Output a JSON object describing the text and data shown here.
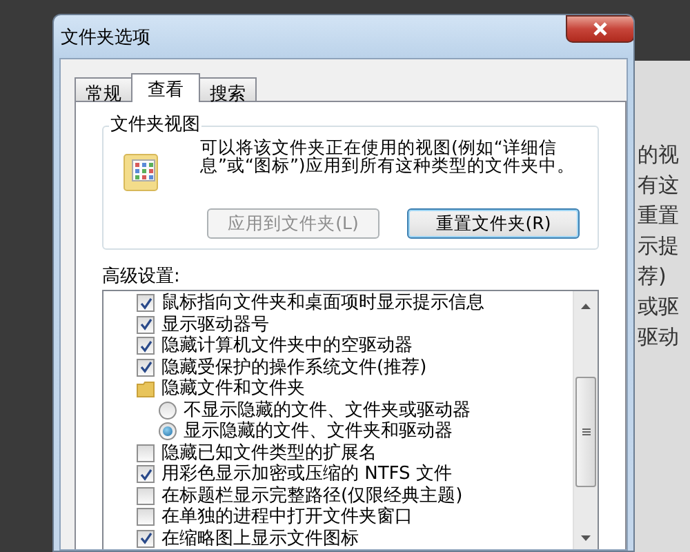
{
  "window": {
    "title": "文件夹选项"
  },
  "tabs": [
    {
      "label": "常规",
      "selected": false
    },
    {
      "label": "查看",
      "selected": true
    },
    {
      "label": "搜索",
      "selected": false
    }
  ],
  "folder_views": {
    "title": "文件夹视图",
    "description": "可以将该文件夹正在使用的视图(例如“详细信息”或“图标”)应用到所有这种类型的文件夹中。",
    "buttons": [
      {
        "label": "应用到文件夹(L)",
        "disabled": true
      },
      {
        "label": "重置文件夹(R)",
        "disabled": false
      }
    ]
  },
  "advanced": {
    "label": "高级设置:",
    "items": [
      {
        "kind": "checkbox",
        "label": "鼠标指向文件夹和桌面项时显示提示信息",
        "checked": true
      },
      {
        "kind": "checkbox",
        "label": "显示驱动器号",
        "checked": true
      },
      {
        "kind": "checkbox",
        "label": "隐藏计算机文件夹中的空驱动器",
        "checked": true
      },
      {
        "kind": "checkbox",
        "label": "隐藏受保护的操作系统文件(推荐)",
        "checked": true
      },
      {
        "kind": "folder",
        "label": "隐藏文件和文件夹",
        "children": [
          {
            "kind": "radio",
            "label": "不显示隐藏的文件、文件夹或驱动器",
            "selected": false
          },
          {
            "kind": "radio",
            "label": "显示隐藏的文件、文件夹和驱动器",
            "selected": true
          }
        ]
      },
      {
        "kind": "checkbox",
        "label": "隐藏已知文件类型的扩展名",
        "checked": false
      },
      {
        "kind": "checkbox",
        "label": "用彩色显示加密或压缩的 NTFS 文件",
        "checked": true
      },
      {
        "kind": "checkbox",
        "label": "在标题栏显示完整路径(仅限经典主题)",
        "checked": false
      },
      {
        "kind": "checkbox",
        "label": "在单独的进程中打开文件夹窗口",
        "checked": false
      },
      {
        "kind": "checkbox",
        "label": "在缩略图上显示文件图标",
        "checked": true
      }
    ]
  },
  "background_window": {
    "texts": [
      "的视",
      "有这",
      "重置",
      "示提",
      "荐)",
      "或驱",
      "驱动"
    ]
  }
}
